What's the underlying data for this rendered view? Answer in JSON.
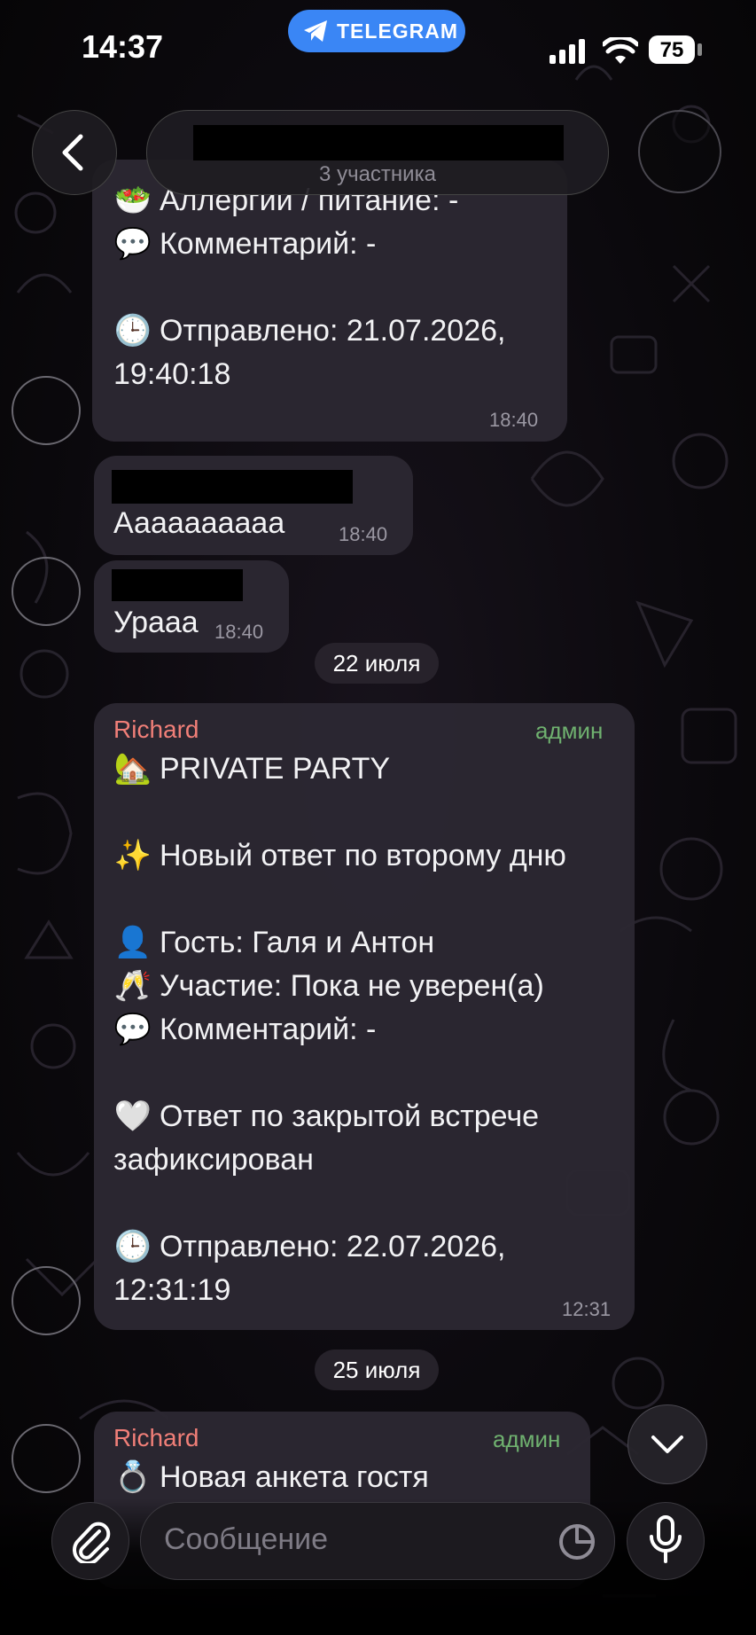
{
  "status_bar": {
    "time": "14:37",
    "telegram_label": "TELEGRAM",
    "battery": "75"
  },
  "header": {
    "subtitle": "3 участника"
  },
  "messages": {
    "form_tail": {
      "line_allergy": "Аллергии / питание: -",
      "line_comment": "Комментарий: -",
      "line_sent_1": "Отправлено: 21.07.2026,",
      "line_sent_2": "19:40:18",
      "time": "18:40"
    },
    "reply_a": {
      "text": "Ааааааааaa",
      "time": "18:40"
    },
    "reply_b": {
      "text": "Урааа",
      "time": "18:40"
    },
    "date_1": "22 июля",
    "party": {
      "sender": "Richard",
      "role": "админ",
      "lines": [
        "PRIVATE PARTY",
        "",
        "Новый ответ по второму дню",
        "",
        "Гость: Галя и Антон",
        "Участие: Пока не уверен(а)",
        "Комментарий: -",
        "",
        "Ответ по закрытой встрече",
        "зафиксирован",
        "",
        "Отправлено: 22.07.2026,",
        "12:31:19"
      ],
      "time": "12:31"
    },
    "date_2": "25 июля",
    "new_form": {
      "sender": "Richard",
      "role": "админ",
      "text": "Новая анкета гостя"
    }
  },
  "composer": {
    "placeholder": "Сообщение"
  },
  "icons": {
    "back": "chevron-left-icon",
    "attach": "paperclip-icon",
    "sticker": "sticker-icon",
    "mic": "microphone-icon",
    "scroll_down": "chevron-down-icon",
    "telegram": "telegram-plane-icon"
  },
  "colors": {
    "sender": "#f17f78",
    "admin": "#6fb16f",
    "chip": "#3a86f5",
    "bubble": "#2c2832"
  }
}
